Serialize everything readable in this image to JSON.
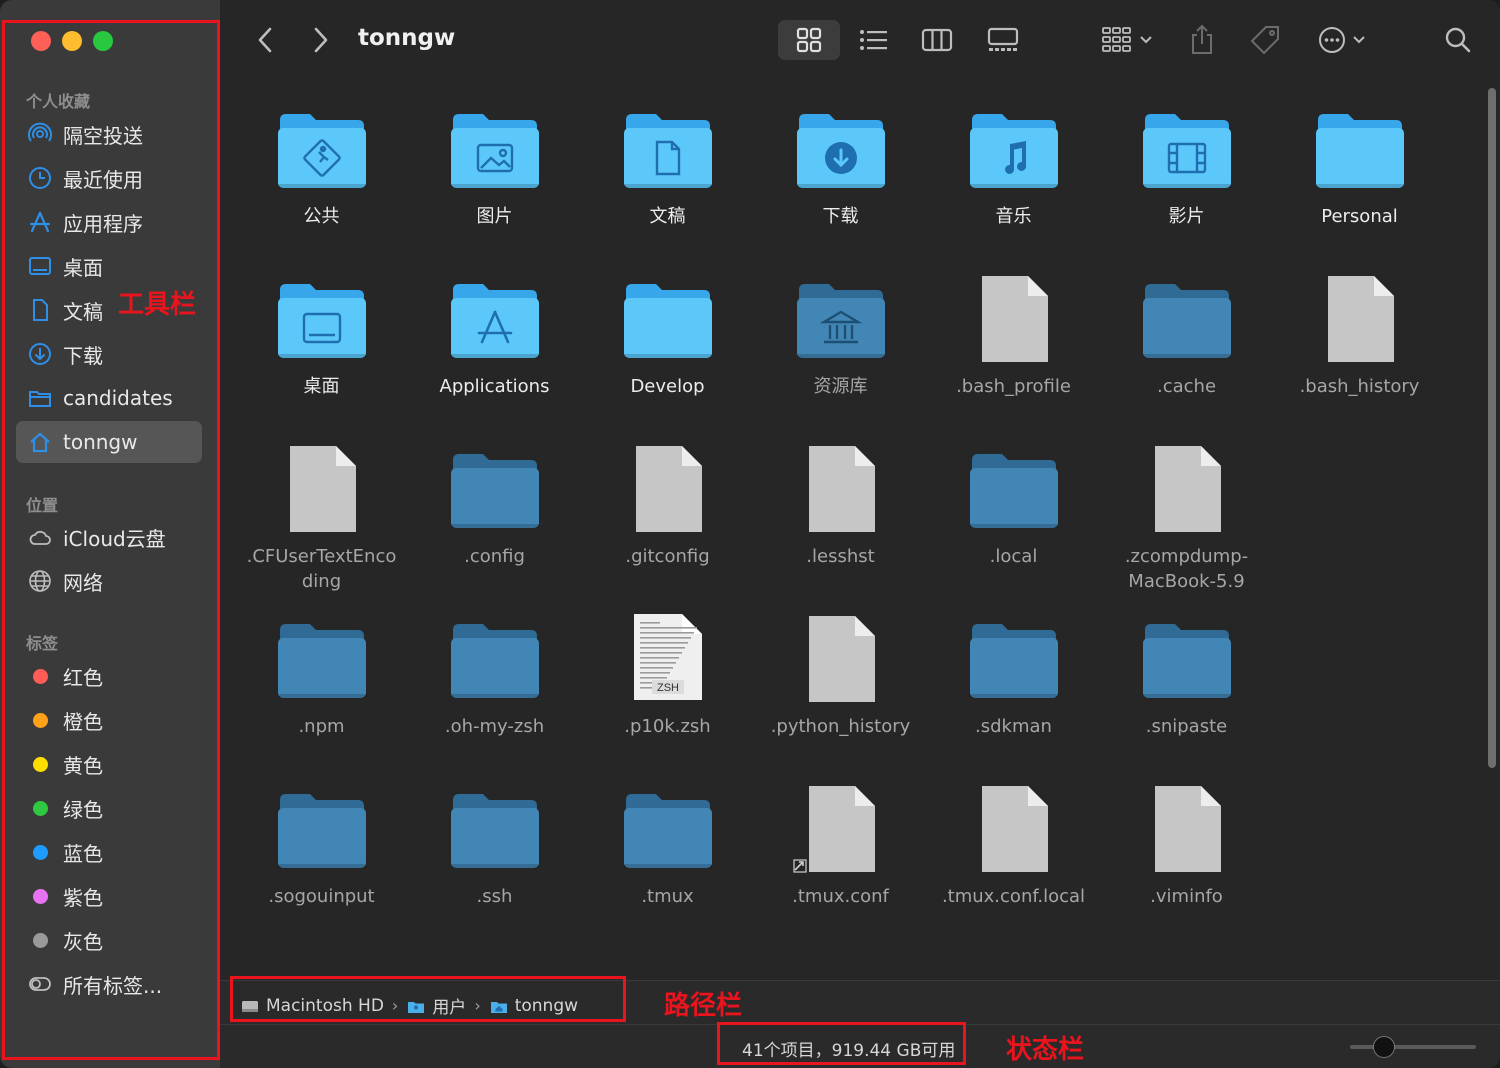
{
  "window": {
    "title": "tonngw"
  },
  "sidebar": {
    "sections": [
      {
        "title": "个人收藏",
        "items": [
          {
            "label": "隔空投送",
            "icon": "airdrop-icon"
          },
          {
            "label": "最近使用",
            "icon": "clock-icon"
          },
          {
            "label": "应用程序",
            "icon": "applications-icon"
          },
          {
            "label": "桌面",
            "icon": "desktop-icon"
          },
          {
            "label": "文稿",
            "icon": "document-icon"
          },
          {
            "label": "下载",
            "icon": "download-icon"
          },
          {
            "label": "candidates",
            "icon": "folder-icon"
          },
          {
            "label": "tonngw",
            "icon": "home-icon",
            "selected": true
          }
        ]
      },
      {
        "title": "位置",
        "items": [
          {
            "label": "iCloud云盘",
            "icon": "cloud-icon"
          },
          {
            "label": "网络",
            "icon": "globe-icon"
          }
        ]
      },
      {
        "title": "标签",
        "items": [
          {
            "label": "红色",
            "color": "#ff5b57"
          },
          {
            "label": "橙色",
            "color": "#ffa21a"
          },
          {
            "label": "黄色",
            "color": "#ffdd00"
          },
          {
            "label": "绿色",
            "color": "#2fc840"
          },
          {
            "label": "蓝色",
            "color": "#1e9bff"
          },
          {
            "label": "紫色",
            "color": "#e873f2"
          },
          {
            "label": "灰色",
            "color": "#9a9a9a"
          },
          {
            "label": "所有标签...",
            "icon": "all-tags-icon"
          }
        ]
      }
    ]
  },
  "toolbar": {
    "back": "back-chevron-icon",
    "forward": "forward-chevron-icon",
    "views": [
      "icon-view-icon",
      "list-view-icon",
      "column-view-icon",
      "gallery-view-icon"
    ],
    "actions": [
      "group-icon",
      "share-icon",
      "tag-icon",
      "more-icon",
      "search-icon"
    ]
  },
  "files": [
    {
      "name": "公共",
      "kind": "folder-bright",
      "glyph": "public"
    },
    {
      "name": "图片",
      "kind": "folder-bright",
      "glyph": "pictures"
    },
    {
      "name": "文稿",
      "kind": "folder-bright",
      "glyph": "documents"
    },
    {
      "name": "下载",
      "kind": "folder-bright",
      "glyph": "downloads"
    },
    {
      "name": "音乐",
      "kind": "folder-bright",
      "glyph": "music"
    },
    {
      "name": "影片",
      "kind": "folder-bright",
      "glyph": "movies"
    },
    {
      "name": "Personal",
      "kind": "folder-bright",
      "glyph": ""
    },
    {
      "name": "桌面",
      "kind": "folder-bright",
      "glyph": "desktop"
    },
    {
      "name": "Applications",
      "kind": "folder-bright",
      "glyph": "apps"
    },
    {
      "name": "Develop",
      "kind": "folder-bright",
      "glyph": ""
    },
    {
      "name": "资源库",
      "kind": "folder-dim",
      "glyph": "library"
    },
    {
      "name": ".bash_profile",
      "kind": "doc"
    },
    {
      "name": ".cache",
      "kind": "folder-dim"
    },
    {
      "name": ".bash_history",
      "kind": "doc"
    },
    {
      "name": ".CFUserTextEnco\nding",
      "kind": "doc"
    },
    {
      "name": ".config",
      "kind": "folder-dim"
    },
    {
      "name": ".gitconfig",
      "kind": "doc"
    },
    {
      "name": ".lesshst",
      "kind": "doc"
    },
    {
      "name": ".local",
      "kind": "folder-dim"
    },
    {
      "name": ".zcompdump-\nMacBook-5.9",
      "kind": "doc"
    },
    {
      "name": "",
      "kind": "empty"
    },
    {
      "name": ".npm",
      "kind": "folder-dim"
    },
    {
      "name": ".oh-my-zsh",
      "kind": "folder-dim"
    },
    {
      "name": ".p10k.zsh",
      "kind": "zsh",
      "badge": "ZSH"
    },
    {
      "name": ".python_history",
      "kind": "doc"
    },
    {
      "name": ".sdkman",
      "kind": "folder-dim"
    },
    {
      "name": ".snipaste",
      "kind": "folder-dim"
    },
    {
      "name": "",
      "kind": "empty"
    },
    {
      "name": ".sogouinput",
      "kind": "folder-dim"
    },
    {
      "name": ".ssh",
      "kind": "folder-dim"
    },
    {
      "name": ".tmux",
      "kind": "folder-dim"
    },
    {
      "name": ".tmux.conf",
      "kind": "doc-alias"
    },
    {
      "name": ".tmux.conf.local",
      "kind": "doc"
    },
    {
      "name": ".viminfo",
      "kind": "doc"
    },
    {
      "name": "",
      "kind": "empty"
    },
    {
      "name": "",
      "kind": "doc-peek"
    },
    {
      "name": "",
      "kind": "folder-peek"
    },
    {
      "name": "",
      "kind": "doc-peek"
    },
    {
      "name": "",
      "kind": "doc-peek"
    },
    {
      "name": "",
      "kind": "doc-peek"
    },
    {
      "name": "",
      "kind": "doc-peek"
    },
    {
      "name": "",
      "kind": "empty"
    }
  ],
  "pathbar": {
    "crumbs": [
      {
        "label": "Macintosh HD",
        "icon": "disk-icon"
      },
      {
        "label": "用户",
        "icon": "users-folder-icon"
      },
      {
        "label": "tonngw",
        "icon": "home-folder-icon"
      }
    ],
    "separator": "›"
  },
  "statusbar": {
    "text": "41个项目，919.44 GB可用",
    "zoom_level": 0.25
  },
  "annotations": {
    "toolbar_label": "工具栏",
    "pathbar_label": "路径栏",
    "statusbar_label": "状态栏",
    "color": "#e8141e"
  }
}
